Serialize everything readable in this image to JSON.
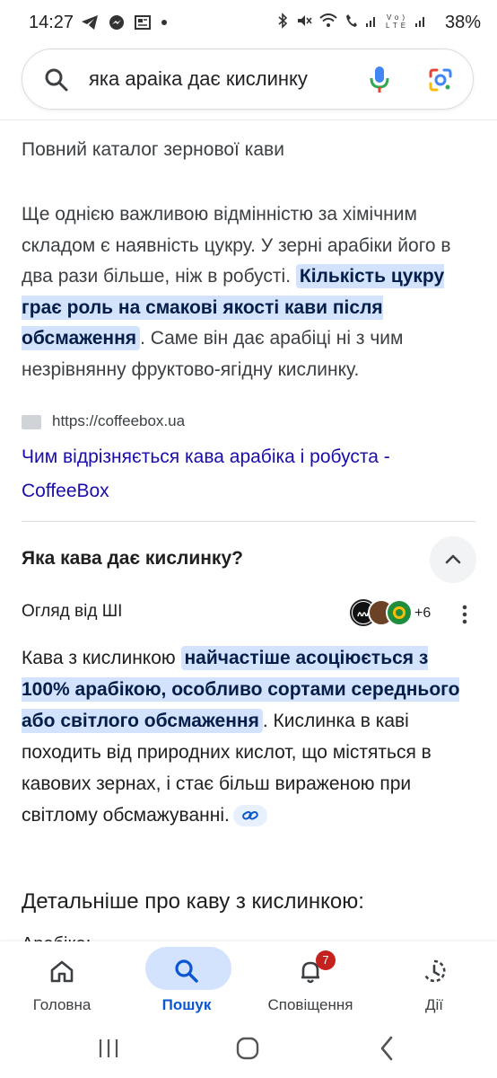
{
  "status": {
    "time": "14:27",
    "left_icons": [
      "telegram-icon",
      "messenger-icon",
      "news-icon",
      "dot-icon"
    ],
    "right_icons": [
      "bluetooth-icon",
      "mute-icon",
      "wifi-icon",
      "call-icon",
      "signal-icon",
      "volte-icon",
      "signal-icon"
    ],
    "battery": "38%"
  },
  "search": {
    "query": "яка араіка дає кислинку"
  },
  "result": {
    "catalog_title": "Повний каталог зернової кави",
    "snippet_before": "Ще однією важливою відмінністю за хімічним складом є наявність цукру. У зерні арабіки його в два рази більше, ніж в робусті. ",
    "snippet_highlight": "Кількість цукру грає роль на смакові якості кави після обсмаження",
    "snippet_after": ". Саме він дає арабіці ні з чим незрівнянну фруктово-ягідну кислинку.",
    "source_url": "https://coffeebox.ua",
    "link_title": "Чим відрізняється кава арабіка і робуста - CoffeeBox"
  },
  "paa": {
    "question": "Яка кава дає кислинку?",
    "ai_label": "Огляд від ШІ",
    "more_sources": "+6",
    "answer_before": "Кава з кислинкою ",
    "answer_highlight": "найчастіше асоціюється з 100% арабікою, особливо сортами середнього або світлого обсмаження",
    "answer_after": ". Кислинка в каві походить від природних кислот, що містяться в кавових зернах, і стає більш вираженою при світлому обсмажуванні.",
    "details_heading": "Детальніше про каву з кислинкою:",
    "clipped_text": "Арабіка:"
  },
  "bottom_nav": {
    "items": [
      {
        "label": "Головна",
        "icon": "home-icon"
      },
      {
        "label": "Пошук",
        "icon": "search-icon"
      },
      {
        "label": "Сповіщення",
        "icon": "bell-icon",
        "badge": "7"
      },
      {
        "label": "Дії",
        "icon": "activity-icon"
      }
    ]
  },
  "colors": {
    "accent": "#0b57d0",
    "highlight_bg": "#d3e3fd",
    "link": "#1a0dab",
    "badge": "#c5221f"
  }
}
